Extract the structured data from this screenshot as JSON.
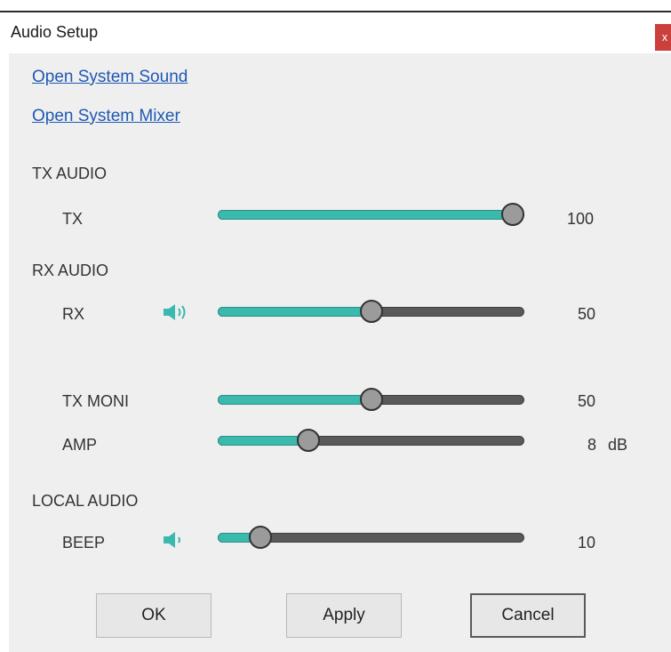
{
  "window": {
    "title": "Audio Setup",
    "close_glyph": "x"
  },
  "links": {
    "system_sound": "Open System Sound",
    "system_mixer": "Open System Mixer"
  },
  "sections": {
    "tx": "TX AUDIO",
    "rx": "RX AUDIO",
    "local": "LOCAL AUDIO"
  },
  "controls": {
    "tx": {
      "label": "TX",
      "value": "100",
      "level": 1.0
    },
    "rx": {
      "label": "RX",
      "value": "50",
      "level": 0.5,
      "icon": "speaker-icon"
    },
    "tx_moni": {
      "label": "TX MONI",
      "value": "50",
      "level": 0.5
    },
    "amp": {
      "label": "AMP",
      "value": "8",
      "unit": "dB",
      "level": 0.28
    },
    "beep": {
      "label": "BEEP",
      "value": "10",
      "level": 0.11,
      "icon": "speaker-icon"
    }
  },
  "buttons": {
    "ok": "OK",
    "apply": "Apply",
    "cancel": "Cancel"
  },
  "colors": {
    "accent": "#3ab9ad",
    "link": "#1e59b3",
    "close": "#c9403c"
  }
}
